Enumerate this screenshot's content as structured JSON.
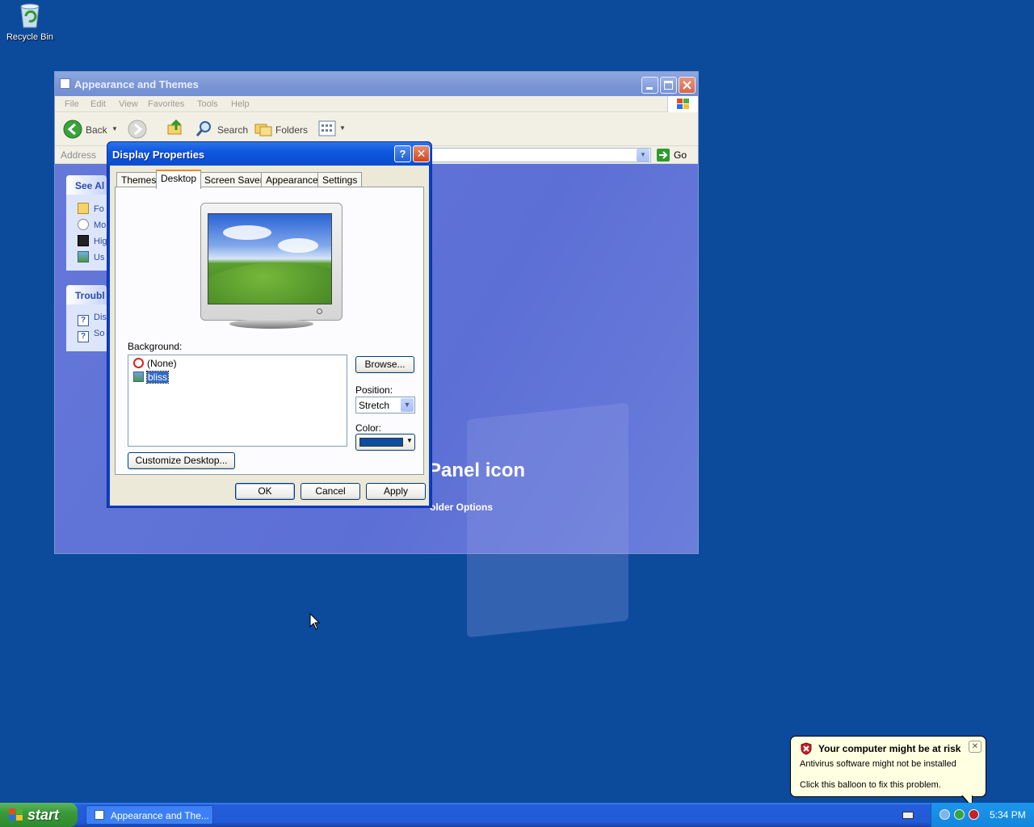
{
  "desktop": {
    "recycle_bin_label": "Recycle Bin"
  },
  "explorer": {
    "title": "Appearance and Themes",
    "menu": [
      "File",
      "Edit",
      "View",
      "Favorites",
      "Tools",
      "Help"
    ],
    "toolbar": {
      "back": "Back",
      "search": "Search",
      "folders": "Folders"
    },
    "address_label": "Address",
    "go_label": "Go",
    "see_also_header": "See Al",
    "see_also_items": [
      "Fo",
      "Mo",
      "Hig",
      "Us"
    ],
    "troubleshoot_header": "Troubl",
    "troubleshoot_items": [
      "Dis",
      "So"
    ],
    "main_heading": "Panel icon",
    "main_link": "older Options"
  },
  "dialog": {
    "title": "Display Properties",
    "tabs": [
      "Themes",
      "Desktop",
      "Screen Saver",
      "Appearance",
      "Settings"
    ],
    "active_tab": "Desktop",
    "background_label": "Background:",
    "background_items": [
      {
        "label": "(None)",
        "icon": "none-icon",
        "selected": false
      },
      {
        "label": "bliss",
        "icon": "image-file-icon",
        "selected": true
      }
    ],
    "browse_label": "Browse...",
    "position_label": "Position:",
    "position_value": "Stretch",
    "color_label": "Color:",
    "color_value": "#0a4ea3",
    "customize_label": "Customize Desktop...",
    "ok_label": "OK",
    "cancel_label": "Cancel",
    "apply_label": "Apply",
    "help_glyph": "?",
    "close_glyph": "✕"
  },
  "taskbar": {
    "start_label": "start",
    "task_item": "Appearance and The...",
    "clock": "5:34 PM"
  },
  "balloon": {
    "title": "Your computer might be at risk",
    "line1": "Antivirus software might not be installed",
    "line2": "Click this balloon to fix this problem.",
    "close_glyph": "✕"
  },
  "colors": {
    "desktop": "#0c4a9c",
    "dialog_title": "#0a4ccf",
    "active_tab_accent": "#e68b2c"
  }
}
